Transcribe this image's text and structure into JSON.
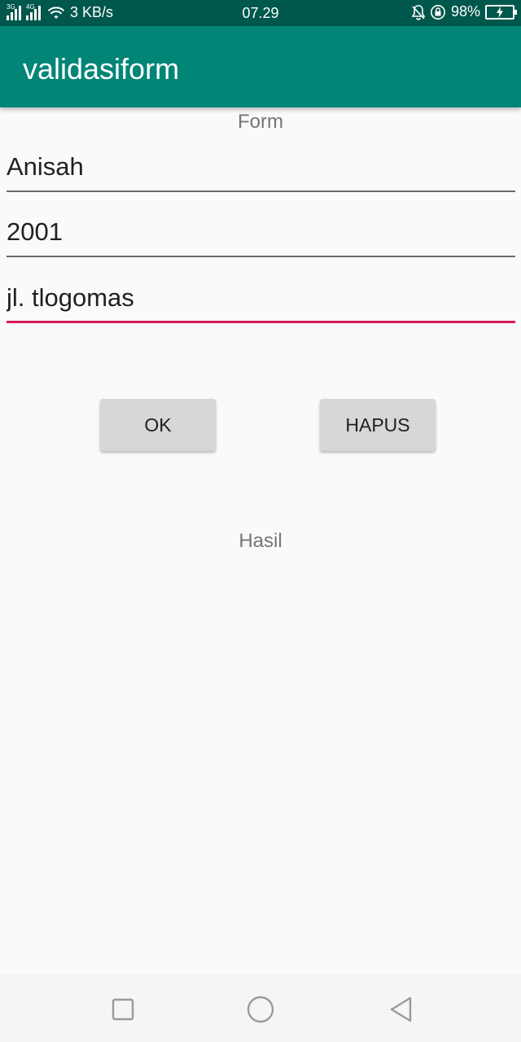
{
  "status_bar": {
    "network_tag_1": "3G",
    "network_tag_2": "4G",
    "speed": "3 KB/s",
    "time": "07.29",
    "battery": "98%",
    "battery_level": 0.98,
    "battery_color": "#6fdc4b"
  },
  "app_bar": {
    "title": "validasiform",
    "color": "#008577"
  },
  "form": {
    "heading": "Form",
    "fields": [
      {
        "value": "Anisah"
      },
      {
        "value": "2001"
      },
      {
        "value": "jl. tlogomas"
      }
    ],
    "focus_color": "#d81b60"
  },
  "buttons": {
    "ok_label": "OK",
    "hapus_label": "HAPUS"
  },
  "result": {
    "label": "Hasil"
  },
  "nav": {
    "icons": [
      "square-recent-icon",
      "circle-home-icon",
      "triangle-back-icon"
    ]
  }
}
